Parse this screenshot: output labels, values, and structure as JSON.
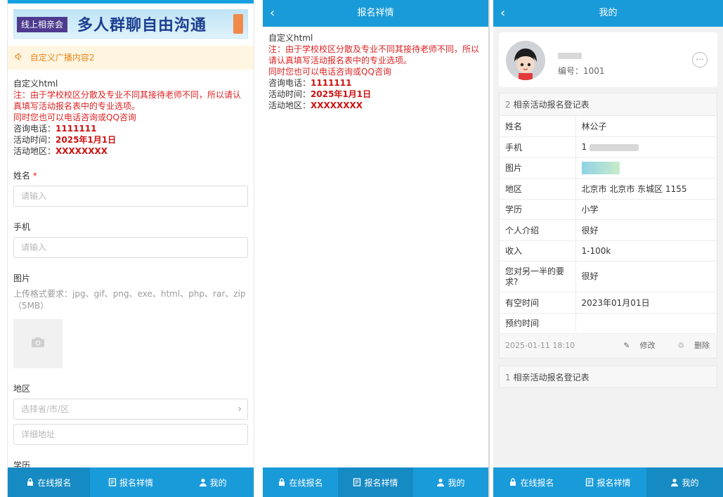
{
  "form": {
    "banner_tag": "线上相亲会",
    "banner_title": "多人群聊自由沟通",
    "notice": "自定义广播内容2",
    "intro_title": "自定义html",
    "intro_note": "注：由于学校校区分散及专业不同其接待老师不同，所以请认真填写活动报名表中的专业选项。",
    "intro_note2": "同时您也可以电话咨询或QQ咨询",
    "phone_label": "咨询电话：",
    "phone_value": "1111111",
    "time_label": "活动时间：",
    "time_value": "2025年1月1日",
    "area_label": "活动地区：",
    "area_value": "XXXXXXXX",
    "name_label": "姓名",
    "required_mark": "*",
    "name_placeholder": "请输入",
    "mobile_label": "手机",
    "mobile_placeholder": "请输入",
    "image_label": "图片",
    "image_hint": "上传格式要求：jpg、gif、png、exe、html、php、rar、zip（5MB）",
    "region_label": "地区",
    "region_placeholder": "选择省/市/区",
    "address_placeholder": "详细地址",
    "education_label": "学历"
  },
  "detail": {
    "title": "报名祥情",
    "intro_title": "自定义html",
    "intro_note": "注：由于学校校区分散及专业不同其接待老师不同，所以请认真填写活动报名表中的专业选项。",
    "intro_note2": "同时您也可以电话咨询或QQ咨询",
    "phone_label": "咨询电话：",
    "phone_value": "1111111",
    "time_label": "活动时间：",
    "time_value": "2025年1月1日",
    "area_label": "活动地区：",
    "area_value": "XXXXXXXX"
  },
  "mine": {
    "title": "我的",
    "user_id": "编号：1001",
    "card1_num": "2",
    "card1_title": "相亲活动报名登记表",
    "rows": [
      {
        "k": "姓名",
        "v": "林公子"
      },
      {
        "k": "手机",
        "v": "1"
      },
      {
        "k": "图片",
        "v": ""
      },
      {
        "k": "地区",
        "v": "北京市 北京市 东城区 1155"
      },
      {
        "k": "学历",
        "v": "小学"
      },
      {
        "k": "个人介绍",
        "v": "很好"
      },
      {
        "k": "收入",
        "v": "1-100k"
      },
      {
        "k": "您对另一半的要求?",
        "v": "很好"
      },
      {
        "k": "有空时间",
        "v": "2023年01月01日"
      },
      {
        "k": "预约时间",
        "v": ""
      }
    ],
    "timestamp": "2025-01-11 18:10",
    "edit_label": "修改",
    "delete_label": "删除",
    "card2_num": "1",
    "card2_title": "相亲活动报名登记表"
  },
  "nav": {
    "signup": "在线报名",
    "details": "报名祥情",
    "mine": "我的"
  },
  "colors": {
    "primary": "#1a9bd9",
    "notice_bg": "#fff5e1",
    "notice_text": "#e6881e",
    "alert": "#d22222"
  }
}
